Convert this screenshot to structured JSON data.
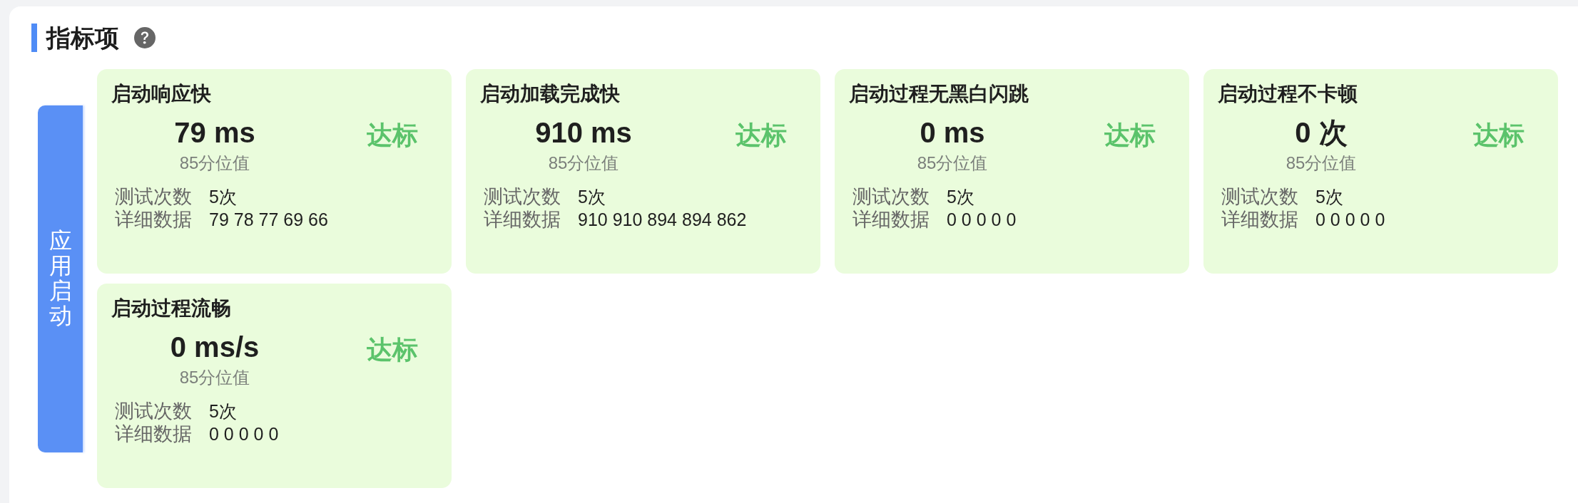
{
  "header": {
    "title": "指标项"
  },
  "categories": [
    {
      "label": "应用启动",
      "metrics": [
        {
          "title": "启动响应快",
          "value": "79 ms",
          "caption": "85分位值",
          "status": {
            "text": "达标",
            "passed": true
          },
          "stats": [
            {
              "label": "测试次数",
              "value": "5次"
            },
            {
              "label": "详细数据",
              "value": "79 78 77 69 66"
            }
          ]
        },
        {
          "title": "启动加载完成快",
          "value": "910 ms",
          "caption": "85分位值",
          "status": {
            "text": "达标",
            "passed": true
          },
          "stats": [
            {
              "label": "测试次数",
              "value": "5次"
            },
            {
              "label": "详细数据",
              "value": "910 910 894 894 862"
            }
          ]
        },
        {
          "title": "启动过程无黑白闪跳",
          "value": "0 ms",
          "caption": "85分位值",
          "status": {
            "text": "达标",
            "passed": true
          },
          "stats": [
            {
              "label": "测试次数",
              "value": "5次"
            },
            {
              "label": "详细数据",
              "value": "0 0 0 0 0"
            }
          ]
        },
        {
          "title": "启动过程不卡顿",
          "value": "0 次",
          "caption": "85分位值",
          "status": {
            "text": "达标",
            "passed": true
          },
          "stats": [
            {
              "label": "测试次数",
              "value": "5次"
            },
            {
              "label": "详细数据",
              "value": "0 0 0 0 0"
            }
          ]
        },
        {
          "title": "启动过程流畅",
          "value": "0 ms/s",
          "caption": "85分位值",
          "status": {
            "text": "达标",
            "passed": true
          },
          "stats": [
            {
              "label": "测试次数",
              "value": "5次"
            },
            {
              "label": "详细数据",
              "value": "0 0 0 0 0"
            }
          ]
        }
      ]
    }
  ]
}
